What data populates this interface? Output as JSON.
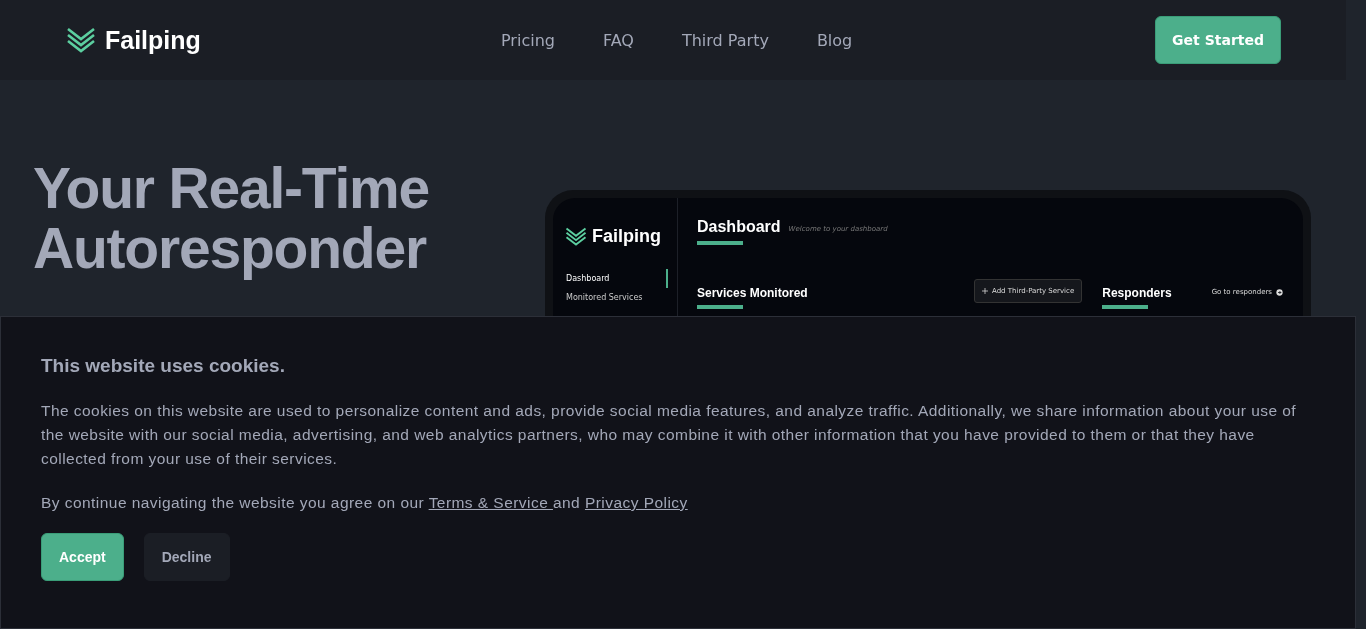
{
  "header": {
    "brand": "Failping",
    "nav": [
      {
        "label": "Pricing"
      },
      {
        "label": "FAQ"
      },
      {
        "label": "Third Party"
      },
      {
        "label": "Blog"
      }
    ],
    "cta": "Get Started"
  },
  "hero": {
    "title_lines": [
      "Your Real-Time",
      "Autoresponder"
    ],
    "preview": {
      "brand": "Failping",
      "nav": [
        {
          "label": "Dashboard",
          "selected": true
        },
        {
          "label": "Monitored Services",
          "selected": false
        }
      ],
      "page_title": "Dashboard",
      "page_subtitle": "Welcome to your dashboard",
      "services_heading": "Services Monitored",
      "add_button": "Add Third-Party Service",
      "responders_heading": "Responders",
      "responders_link": "Go to responders"
    }
  },
  "cookie_banner": {
    "title": "This website uses cookies.",
    "body": "The cookies on this website are used to personalize content and ads, provide social media features, and analyze traffic. Additionally, we share information about your use of the website with our social media, advertising, and web analytics partners, who may combine it with other information that you have provided to them or that they have collected from your use of their services.",
    "consent_prefix": "By continue navigating the website you agree on our",
    "terms_link": "Terms & Service",
    "consent_and": "and",
    "privacy_link": "Privacy Policy",
    "buttons": [
      {
        "label": "Accept",
        "kind": "primary"
      },
      {
        "label": "Decline",
        "kind": "secondary"
      }
    ]
  }
}
